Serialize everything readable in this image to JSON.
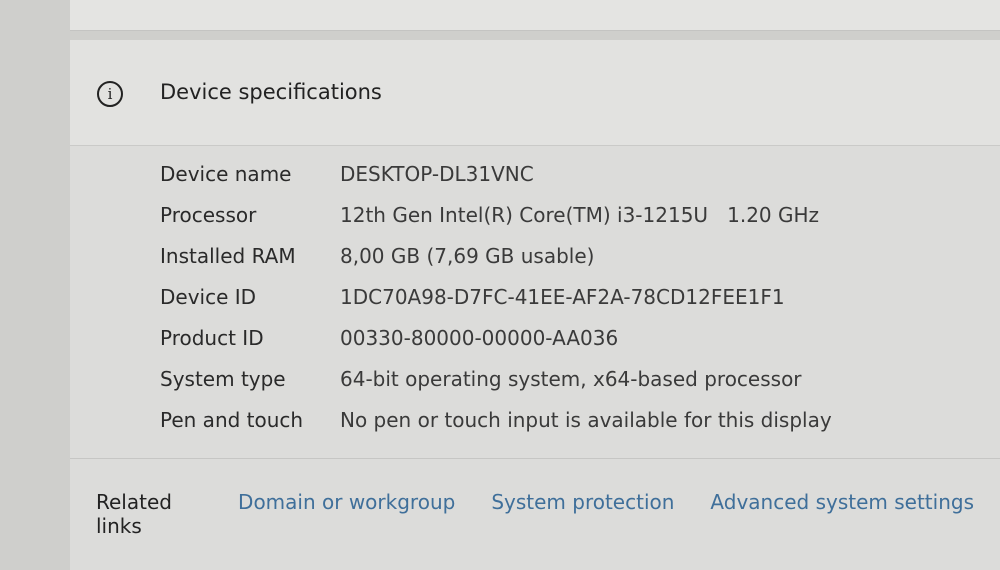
{
  "section": {
    "title": "Device specifications",
    "icon": "info-icon"
  },
  "specs": [
    {
      "label": "Device name",
      "value": "DESKTOP-DL31VNC"
    },
    {
      "label": "Processor",
      "value": "12th Gen Intel(R) Core(TM) i3-1215U   1.20 GHz"
    },
    {
      "label": "Installed RAM",
      "value": "8,00 GB (7,69 GB usable)"
    },
    {
      "label": "Device ID",
      "value": "1DC70A98-D7FC-41EE-AF2A-78CD12FEE1F1"
    },
    {
      "label": "Product ID",
      "value": "00330-80000-00000-AA036"
    },
    {
      "label": "System type",
      "value": "64-bit operating system, x64-based processor"
    },
    {
      "label": "Pen and touch",
      "value": "No pen or touch input is available for this display"
    }
  ],
  "related": {
    "label": "Related links",
    "links": [
      "Domain or workgroup",
      "System protection",
      "Advanced system settings"
    ]
  }
}
